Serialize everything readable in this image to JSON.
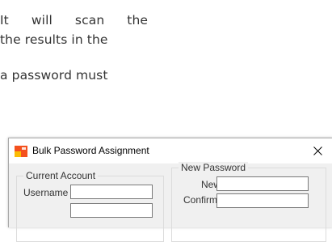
{
  "document": {
    "line1_words": [
      "It",
      "will",
      "scan",
      "the"
    ],
    "line2": "the results in the",
    "line3": "a password must"
  },
  "dialog": {
    "title": "Bulk Password Assignment",
    "close_symbol": "×",
    "current_account": {
      "group_title": "Current Account",
      "username_label": "Username",
      "username_value": ""
    },
    "new_password": {
      "group_title": "New Password",
      "new_label": "New",
      "new_value": "",
      "confirm_label": "Confirm",
      "confirm_value": ""
    }
  },
  "colors": {
    "icon_orange": "#f4511e",
    "icon_yellow": "#fbbc05"
  }
}
